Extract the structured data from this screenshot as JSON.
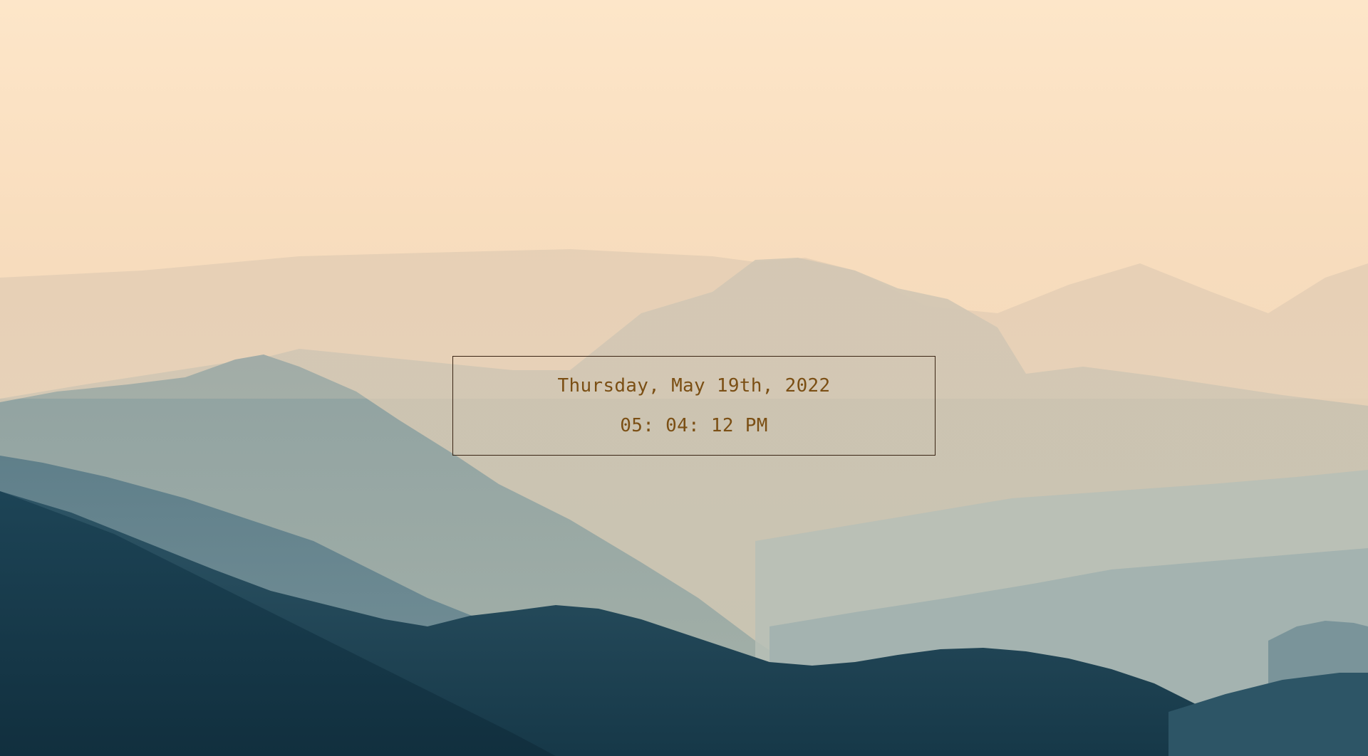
{
  "wallpaper": {
    "icon": "mountain-landscape-icon",
    "colors": {
      "sky": "#fbe4c6",
      "haze": "#e9d4bb",
      "ridge_far": "#d9c8b1",
      "ridge_mid": "#a6b2ad",
      "ridge_near": "#4b6b78",
      "ridge_front": "#183b4b"
    }
  },
  "clock": {
    "date": "Thursday, May 19th, 2022",
    "time": "05: 04: 12 PM",
    "text_color": "#7b4f14",
    "border_color": "#3a2514"
  }
}
